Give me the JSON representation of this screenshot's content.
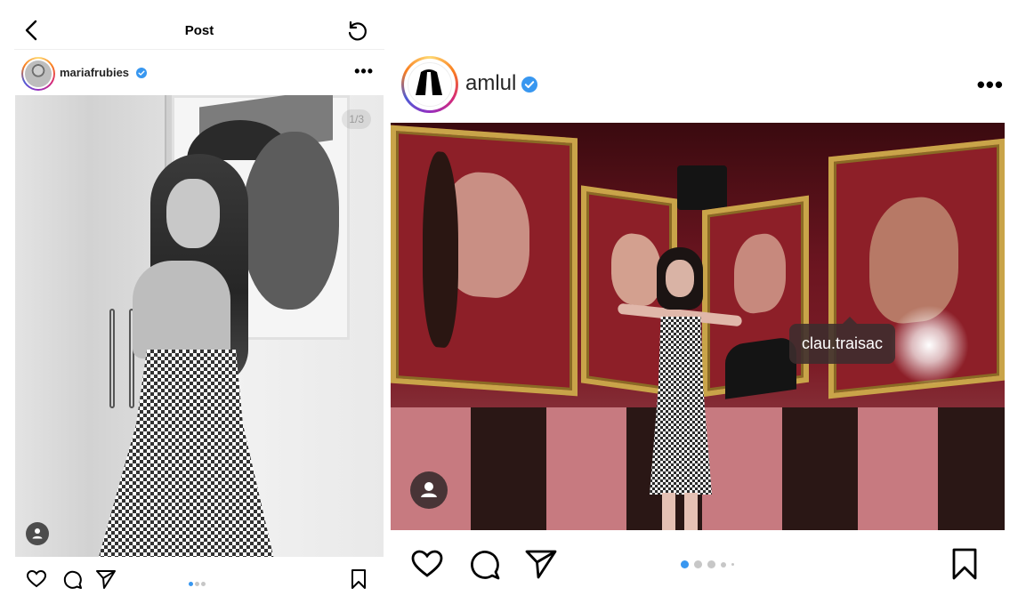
{
  "left_post": {
    "header_title": "Post",
    "username": "maria frubies",
    "username_display": "mariafrubies",
    "carousel_counter": "1/3",
    "carousel_dots": 3,
    "active_dot": 0
  },
  "right_post": {
    "username": "amlul",
    "tag_label": "clau.traisac",
    "carousel_dots": 5,
    "active_dot": 0
  },
  "colors": {
    "verified_blue": "#3897f0",
    "story_ring": "#d62976"
  },
  "icons": {
    "back": "chevron-left-icon",
    "refresh": "refresh-icon",
    "more": "more-horizontal-icon",
    "verified": "verified-badge-icon",
    "like": "heart-icon",
    "comment": "comment-icon",
    "share": "send-icon",
    "save": "bookmark-icon",
    "tag": "user-tag-icon"
  }
}
